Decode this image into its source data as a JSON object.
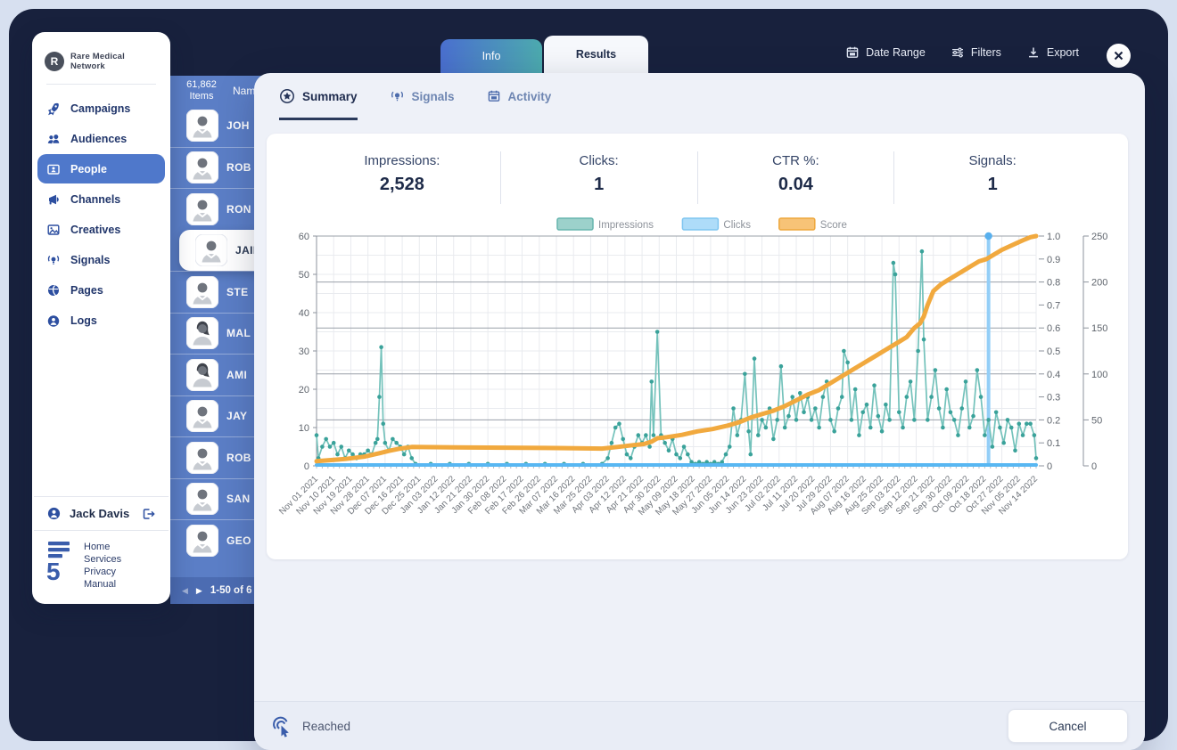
{
  "topbar": {
    "tabs": [
      {
        "label": "Info",
        "active": false
      },
      {
        "label": "Results",
        "active": true
      }
    ],
    "actions": [
      {
        "label": "Date Range",
        "icon": "calendar-icon"
      },
      {
        "label": "Filters",
        "icon": "filters-icon"
      },
      {
        "label": "Export",
        "icon": "download-icon"
      }
    ]
  },
  "sidebar": {
    "brand": "Rare Medical Network",
    "brand_initial": "R",
    "items": [
      {
        "label": "Campaigns",
        "icon": "rocket-icon",
        "active": false
      },
      {
        "label": "Audiences",
        "icon": "users-icon",
        "active": false
      },
      {
        "label": "People",
        "icon": "id-card-icon",
        "active": true
      },
      {
        "label": "Channels",
        "icon": "megaphone-icon",
        "active": false
      },
      {
        "label": "Creatives",
        "icon": "image-icon",
        "active": false
      },
      {
        "label": "Signals",
        "icon": "signal-lamp-icon",
        "active": false
      },
      {
        "label": "Pages",
        "icon": "globe-icon",
        "active": false
      },
      {
        "label": "Logs",
        "icon": "user-circle-icon",
        "active": false
      }
    ],
    "user": {
      "name": "Jack Davis"
    },
    "footer_links": [
      "Home",
      "Services",
      "Privacy",
      "Manual"
    ]
  },
  "people_panel": {
    "items_count": "61,862",
    "items_label": "Items",
    "name_header": "Nam",
    "rows": [
      {
        "name": "JOH",
        "female": false,
        "selected": false
      },
      {
        "name": "ROB",
        "female": false,
        "selected": false
      },
      {
        "name": "RON",
        "female": false,
        "selected": false
      },
      {
        "name": "JAIN",
        "female": false,
        "selected": true
      },
      {
        "name": "STE",
        "female": false,
        "selected": false
      },
      {
        "name": "MAL",
        "female": true,
        "selected": false
      },
      {
        "name": "AMI",
        "female": true,
        "selected": false
      },
      {
        "name": "JAY",
        "female": false,
        "selected": false
      },
      {
        "name": "ROB",
        "female": false,
        "selected": false
      },
      {
        "name": "SAN",
        "female": false,
        "selected": false
      },
      {
        "name": "GEO",
        "female": false,
        "selected": false
      }
    ],
    "pagination": "1-50 of 6"
  },
  "modal": {
    "tabs": [
      {
        "label": "Summary",
        "icon": "star-circle-icon",
        "active": true
      },
      {
        "label": "Signals",
        "icon": "signal-lamp-icon",
        "active": false
      },
      {
        "label": "Activity",
        "icon": "calendar-icon",
        "active": false
      }
    ],
    "stats": [
      {
        "label": "Impressions:",
        "value": "2,528"
      },
      {
        "label": "Clicks:",
        "value": "1"
      },
      {
        "label": "CTR %:",
        "value": "0.04"
      },
      {
        "label": "Signals:",
        "value": "1"
      }
    ],
    "footer": {
      "status_label": "Reached",
      "status_icon": "cursor-click-icon",
      "cancel_label": "Cancel"
    }
  },
  "colors": {
    "frame_dark": "#18213d",
    "panel_blue": "#5b7ec6",
    "accent_blue": "#4f78cb",
    "impressions_teal": "#74c2bb",
    "clicks_blue": "#58b7f2",
    "score_orange": "#f1a93e"
  },
  "chart_data": {
    "type": "line",
    "legend_position": "top-center",
    "grid": true,
    "x_axis": {
      "total_days": 378,
      "tick_labels": [
        "Nov 01 2021",
        "Nov 10 2021",
        "Nov 19 2021",
        "Nov 28 2021",
        "Dec 07 2021",
        "Dec 16 2021",
        "Dec 25 2021",
        "Jan 03 2022",
        "Jan 12 2022",
        "Jan 21 2022",
        "Jan 30 2022",
        "Feb 08 2022",
        "Feb 17 2022",
        "Feb 26 2022",
        "Mar 07 2022",
        "Mar 16 2022",
        "Mar 25 2022",
        "Apr 03 2022",
        "Apr 12 2022",
        "Apr 21 2022",
        "Apr 30 2022",
        "May 09 2022",
        "May 18 2022",
        "May 27 2022",
        "Jun 05 2022",
        "Jun 14 2022",
        "Jun 23 2022",
        "Jul 02 2022",
        "Jul 11 2022",
        "Jul 20 2022",
        "Jul 29 2022",
        "Aug 07 2022",
        "Aug 16 2022",
        "Aug 25 2022",
        "Sep 03 2022",
        "Sep 12 2022",
        "Sep 21 2022",
        "Sep 30 2022",
        "Oct 09 2022",
        "Oct 18 2022",
        "Oct 27 2022",
        "Nov 05 2022",
        "Nov 14 2022"
      ]
    },
    "y_left": {
      "range": [
        0,
        60
      ],
      "ticks": [
        0,
        10,
        20,
        30,
        40,
        50,
        60
      ]
    },
    "y_right_score": {
      "range": [
        0,
        1
      ],
      "ticks": [
        "0",
        "0.1",
        "0.2",
        "0.3",
        "0.4",
        "0.5",
        "0.6",
        "0.7",
        "0.8",
        "0.9",
        "1.0"
      ]
    },
    "y_right_clicks": {
      "range": [
        0,
        250
      ],
      "ticks": [
        0,
        50,
        100,
        150,
        200,
        250
      ]
    },
    "legend": [
      {
        "name": "Impressions",
        "fill": "#9cd1cb",
        "stroke": "#66b5ae"
      },
      {
        "name": "Clicks",
        "fill": "#aedcf9",
        "stroke": "#7ec5f0"
      },
      {
        "name": "Score",
        "fill": "#f7c377",
        "stroke": "#eda73c"
      }
    ],
    "series": {
      "impressions": {
        "axis": "left",
        "points": [
          [
            0,
            8
          ],
          [
            1,
            2
          ],
          [
            3,
            5
          ],
          [
            5,
            7
          ],
          [
            7,
            5
          ],
          [
            9,
            6
          ],
          [
            11,
            3
          ],
          [
            13,
            5
          ],
          [
            15,
            2
          ],
          [
            17,
            4
          ],
          [
            19,
            3
          ],
          [
            21,
            2
          ],
          [
            23,
            3
          ],
          [
            25,
            3
          ],
          [
            27,
            4
          ],
          [
            29,
            3
          ],
          [
            31,
            6
          ],
          [
            32,
            7
          ],
          [
            33,
            18
          ],
          [
            34,
            31
          ],
          [
            35,
            11
          ],
          [
            36,
            6
          ],
          [
            38,
            4
          ],
          [
            40,
            7
          ],
          [
            42,
            6
          ],
          [
            44,
            5
          ],
          [
            46,
            3
          ],
          [
            48,
            5
          ],
          [
            50,
            2
          ],
          [
            52,
            0
          ],
          [
            60,
            0
          ],
          [
            70,
            0
          ],
          [
            80,
            0
          ],
          [
            90,
            0
          ],
          [
            100,
            0
          ],
          [
            110,
            0
          ],
          [
            120,
            0
          ],
          [
            130,
            0
          ],
          [
            140,
            0
          ],
          [
            150,
            0
          ],
          [
            153,
            2
          ],
          [
            155,
            6
          ],
          [
            157,
            10
          ],
          [
            159,
            11
          ],
          [
            161,
            7
          ],
          [
            163,
            3
          ],
          [
            165,
            2
          ],
          [
            167,
            5
          ],
          [
            169,
            8
          ],
          [
            171,
            6
          ],
          [
            173,
            8
          ],
          [
            175,
            5
          ],
          [
            176,
            22
          ],
          [
            177,
            8
          ],
          [
            179,
            35
          ],
          [
            181,
            8
          ],
          [
            183,
            6
          ],
          [
            185,
            4
          ],
          [
            187,
            7
          ],
          [
            189,
            3
          ],
          [
            191,
            2
          ],
          [
            193,
            5
          ],
          [
            195,
            3
          ],
          [
            197,
            1
          ],
          [
            199,
            0
          ],
          [
            201,
            1
          ],
          [
            203,
            0
          ],
          [
            205,
            1
          ],
          [
            207,
            0
          ],
          [
            209,
            1
          ],
          [
            211,
            0
          ],
          [
            213,
            1
          ],
          [
            215,
            3
          ],
          [
            217,
            5
          ],
          [
            219,
            15
          ],
          [
            221,
            8
          ],
          [
            223,
            12
          ],
          [
            225,
            24
          ],
          [
            227,
            9
          ],
          [
            228,
            3
          ],
          [
            230,
            28
          ],
          [
            232,
            8
          ],
          [
            234,
            12
          ],
          [
            236,
            10
          ],
          [
            238,
            15
          ],
          [
            240,
            7
          ],
          [
            242,
            12
          ],
          [
            244,
            26
          ],
          [
            246,
            10
          ],
          [
            248,
            13
          ],
          [
            250,
            18
          ],
          [
            252,
            12
          ],
          [
            254,
            19
          ],
          [
            256,
            14
          ],
          [
            258,
            18
          ],
          [
            260,
            12
          ],
          [
            262,
            15
          ],
          [
            264,
            10
          ],
          [
            266,
            18
          ],
          [
            268,
            22
          ],
          [
            270,
            12
          ],
          [
            272,
            9
          ],
          [
            274,
            15
          ],
          [
            276,
            18
          ],
          [
            277,
            30
          ],
          [
            279,
            27
          ],
          [
            281,
            12
          ],
          [
            283,
            20
          ],
          [
            285,
            8
          ],
          [
            287,
            14
          ],
          [
            289,
            16
          ],
          [
            291,
            10
          ],
          [
            293,
            21
          ],
          [
            295,
            13
          ],
          [
            297,
            9
          ],
          [
            299,
            16
          ],
          [
            301,
            12
          ],
          [
            303,
            53
          ],
          [
            304,
            50
          ],
          [
            306,
            14
          ],
          [
            308,
            10
          ],
          [
            310,
            18
          ],
          [
            312,
            22
          ],
          [
            314,
            12
          ],
          [
            316,
            30
          ],
          [
            318,
            56
          ],
          [
            319,
            33
          ],
          [
            321,
            12
          ],
          [
            323,
            18
          ],
          [
            325,
            25
          ],
          [
            327,
            15
          ],
          [
            329,
            10
          ],
          [
            331,
            20
          ],
          [
            333,
            14
          ],
          [
            335,
            12
          ],
          [
            337,
            8
          ],
          [
            339,
            15
          ],
          [
            341,
            22
          ],
          [
            343,
            10
          ],
          [
            345,
            13
          ],
          [
            347,
            25
          ],
          [
            349,
            18
          ],
          [
            351,
            8
          ],
          [
            353,
            12
          ],
          [
            355,
            5
          ],
          [
            357,
            14
          ],
          [
            359,
            10
          ],
          [
            361,
            6
          ],
          [
            363,
            12
          ],
          [
            365,
            10
          ],
          [
            367,
            4
          ],
          [
            369,
            11
          ],
          [
            371,
            8
          ],
          [
            373,
            11
          ],
          [
            375,
            11
          ],
          [
            377,
            8
          ],
          [
            378,
            2
          ]
        ]
      },
      "clicks": {
        "axis": "clicks",
        "points": [
          [
            0,
            0
          ],
          [
            352,
            0
          ],
          [
            353,
            250
          ],
          [
            354,
            0
          ],
          [
            378,
            0
          ]
        ]
      },
      "score": {
        "axis": "score",
        "points": [
          [
            0,
            0.02
          ],
          [
            15,
            0.03
          ],
          [
            25,
            0.04
          ],
          [
            33,
            0.055
          ],
          [
            38,
            0.065
          ],
          [
            44,
            0.075
          ],
          [
            50,
            0.082
          ],
          [
            80,
            0.08
          ],
          [
            120,
            0.078
          ],
          [
            150,
            0.075
          ],
          [
            158,
            0.082
          ],
          [
            166,
            0.09
          ],
          [
            172,
            0.095
          ],
          [
            176,
            0.105
          ],
          [
            179,
            0.12
          ],
          [
            184,
            0.125
          ],
          [
            192,
            0.135
          ],
          [
            200,
            0.15
          ],
          [
            208,
            0.16
          ],
          [
            216,
            0.175
          ],
          [
            222,
            0.19
          ],
          [
            228,
            0.21
          ],
          [
            234,
            0.225
          ],
          [
            240,
            0.24
          ],
          [
            246,
            0.26
          ],
          [
            252,
            0.285
          ],
          [
            258,
            0.31
          ],
          [
            264,
            0.33
          ],
          [
            270,
            0.36
          ],
          [
            276,
            0.39
          ],
          [
            282,
            0.42
          ],
          [
            288,
            0.45
          ],
          [
            294,
            0.48
          ],
          [
            300,
            0.51
          ],
          [
            306,
            0.54
          ],
          [
            310,
            0.56
          ],
          [
            314,
            0.6
          ],
          [
            317,
            0.62
          ],
          [
            319,
            0.65
          ],
          [
            321,
            0.7
          ],
          [
            324,
            0.76
          ],
          [
            328,
            0.79
          ],
          [
            332,
            0.81
          ],
          [
            336,
            0.83
          ],
          [
            340,
            0.85
          ],
          [
            344,
            0.87
          ],
          [
            348,
            0.89
          ],
          [
            352,
            0.9
          ],
          [
            356,
            0.92
          ],
          [
            360,
            0.94
          ],
          [
            364,
            0.955
          ],
          [
            368,
            0.97
          ],
          [
            372,
            0.985
          ],
          [
            375,
            0.995
          ],
          [
            378,
            1.0
          ]
        ]
      }
    }
  }
}
